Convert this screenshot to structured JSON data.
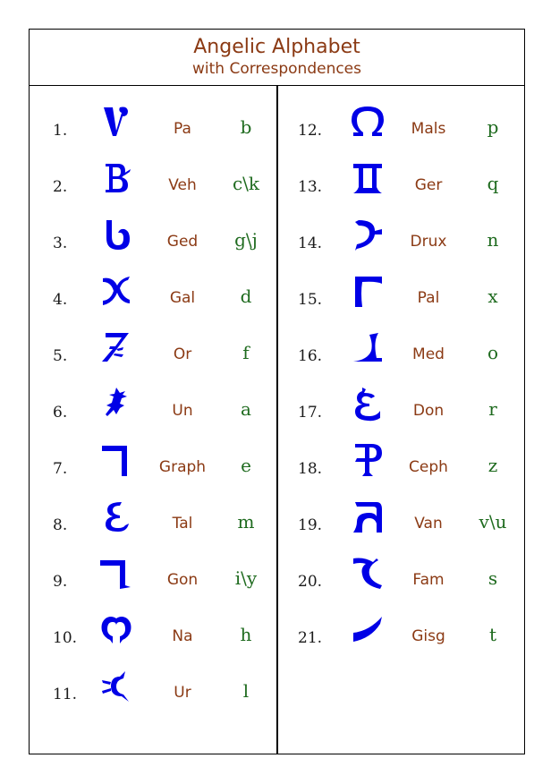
{
  "header": {
    "title": "Angelic Alphabet",
    "subtitle": "with Correspondences"
  },
  "colors": {
    "glyph": "#0000e6",
    "name": "#8b3a14",
    "letter": "#1f6b1f",
    "number": "#1a1a1a",
    "border": "#000000"
  },
  "left_column": [
    {
      "number": "1.",
      "glyph_icon": "angelic-pa-icon",
      "name": "Pa",
      "letter": "b"
    },
    {
      "number": "2.",
      "glyph_icon": "angelic-veh-icon",
      "name": "Veh",
      "letter": "c\\k"
    },
    {
      "number": "3.",
      "glyph_icon": "angelic-ged-icon",
      "name": "Ged",
      "letter": "g\\j"
    },
    {
      "number": "4.",
      "glyph_icon": "angelic-gal-icon",
      "name": "Gal",
      "letter": "d"
    },
    {
      "number": "5.",
      "glyph_icon": "angelic-or-icon",
      "name": "Or",
      "letter": "f"
    },
    {
      "number": "6.",
      "glyph_icon": "angelic-un-icon",
      "name": "Un",
      "letter": "a"
    },
    {
      "number": "7.",
      "glyph_icon": "angelic-graph-icon",
      "name": "Graph",
      "letter": "e"
    },
    {
      "number": "8.",
      "glyph_icon": "angelic-tal-icon",
      "name": "Tal",
      "letter": "m"
    },
    {
      "number": "9.",
      "glyph_icon": "angelic-gon-icon",
      "name": "Gon",
      "letter": "i\\y"
    },
    {
      "number": "10.",
      "glyph_icon": "angelic-na-icon",
      "name": "Na",
      "letter": "h"
    },
    {
      "number": "11.",
      "glyph_icon": "angelic-ur-icon",
      "name": "Ur",
      "letter": "l"
    }
  ],
  "right_column": [
    {
      "number": "12.",
      "glyph_icon": "angelic-mals-icon",
      "name": "Mals",
      "letter": "p"
    },
    {
      "number": "13.",
      "glyph_icon": "angelic-ger-icon",
      "name": "Ger",
      "letter": "q"
    },
    {
      "number": "14.",
      "glyph_icon": "angelic-drux-icon",
      "name": "Drux",
      "letter": "n"
    },
    {
      "number": "15.",
      "glyph_icon": "angelic-pal-icon",
      "name": "Pal",
      "letter": "x"
    },
    {
      "number": "16.",
      "glyph_icon": "angelic-med-icon",
      "name": "Med",
      "letter": "o"
    },
    {
      "number": "17.",
      "glyph_icon": "angelic-don-icon",
      "name": "Don",
      "letter": "r"
    },
    {
      "number": "18.",
      "glyph_icon": "angelic-ceph-icon",
      "name": "Ceph",
      "letter": "z"
    },
    {
      "number": "19.",
      "glyph_icon": "angelic-van-icon",
      "name": "Van",
      "letter": "v\\u"
    },
    {
      "number": "20.",
      "glyph_icon": "angelic-fam-icon",
      "name": "Fam",
      "letter": "s"
    },
    {
      "number": "21.",
      "glyph_icon": "angelic-gisg-icon",
      "name": "Gisg",
      "letter": "t"
    }
  ]
}
